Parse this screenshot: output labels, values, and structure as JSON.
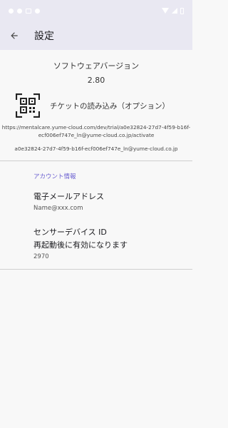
{
  "status_bar": {
    "icons": [
      "notification-dot-icon",
      "notification-dot-icon",
      "notification-box-icon",
      "notification-dot-icon",
      "wifi-icon",
      "signal-icon",
      "battery-icon"
    ]
  },
  "app_bar": {
    "title": "設定",
    "back_icon": "arrow-back-icon"
  },
  "version": {
    "label": "ソフトウェアバージョン",
    "value": "2.80"
  },
  "ticket": {
    "icon": "qr-code-icon",
    "label": "チケットの読み込み（オプション）",
    "url": "https://mentalcare.yume-cloud.com/dev/trial/a0e32824-27d7-4f59-b16f-ecf006ef747e_ln@yume-cloud.co.jp/activate",
    "id": "a0e32824-27d7-4f59-b16f-ecf006ef747e_ln@yume-cloud.co.jp"
  },
  "account": {
    "header": "アカウント情報",
    "email_title": "電子メールアドレス",
    "email_value": "Name@xxx.com",
    "sensor_title": "センサーデバイス ID",
    "sensor_subtitle": "再起動後に有効になります",
    "sensor_value": "2970"
  },
  "colors": {
    "app_bar_bg": "#e9e8f2",
    "accent": "#6a5fd0",
    "background": "#f8f8f8"
  }
}
